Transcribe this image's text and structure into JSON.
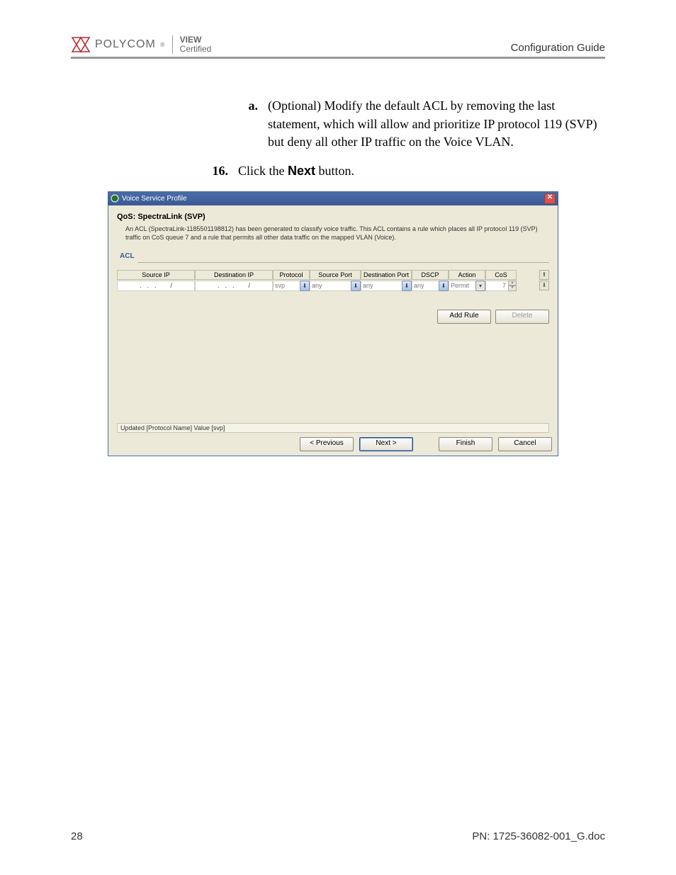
{
  "header": {
    "brand": "POLYCOM",
    "badge_line1": "VIEW",
    "badge_line2": "Certified",
    "right": "Configuration Guide"
  },
  "body": {
    "item_a": {
      "label": "a.",
      "text": "(Optional) Modify the default ACL by removing the last statement, which will allow and prioritize IP protocol 119 (SVP) but deny all other IP traffic on the Voice VLAN."
    },
    "item_16": {
      "label": "16.",
      "text_prefix": "Click the ",
      "bold": "Next",
      "text_suffix": " button."
    }
  },
  "dialog": {
    "title": "Voice Service Profile",
    "heading": "QoS: SpectraLink (SVP)",
    "description": "An ACL (SpectraLink-1185501198812) has been generated to classify voice traffic. This ACL contains a rule which places all IP protocol 119 (SVP) traffic on CoS queue 7 and a rule that permits all other data traffic on the mapped VLAN (Voice).",
    "acl_legend": "ACL",
    "columns": {
      "source_ip": "Source IP",
      "dest_ip": "Destination IP",
      "protocol": "Protocol",
      "source_port": "Source Port",
      "dest_port": "Destination Port",
      "dscp": "DSCP",
      "action": "Action",
      "cos": "CoS"
    },
    "row": {
      "source_ip": ". . .",
      "source_mask": "/",
      "dest_ip": ". . .",
      "dest_mask": "/",
      "protocol": "svp",
      "source_port": "any",
      "dest_port": "any",
      "dscp": "any",
      "action": "Permit",
      "cos": "7"
    },
    "buttons": {
      "add_rule": "Add Rule",
      "delete": "Delete"
    },
    "status": "Updated [Protocol Name] Value [svp]",
    "wizard": {
      "previous": "< Previous",
      "next": "Next >",
      "finish": "Finish",
      "cancel": "Cancel"
    }
  },
  "footer": {
    "page": "28",
    "pn": "PN: 1725-36082-001_G.doc"
  }
}
